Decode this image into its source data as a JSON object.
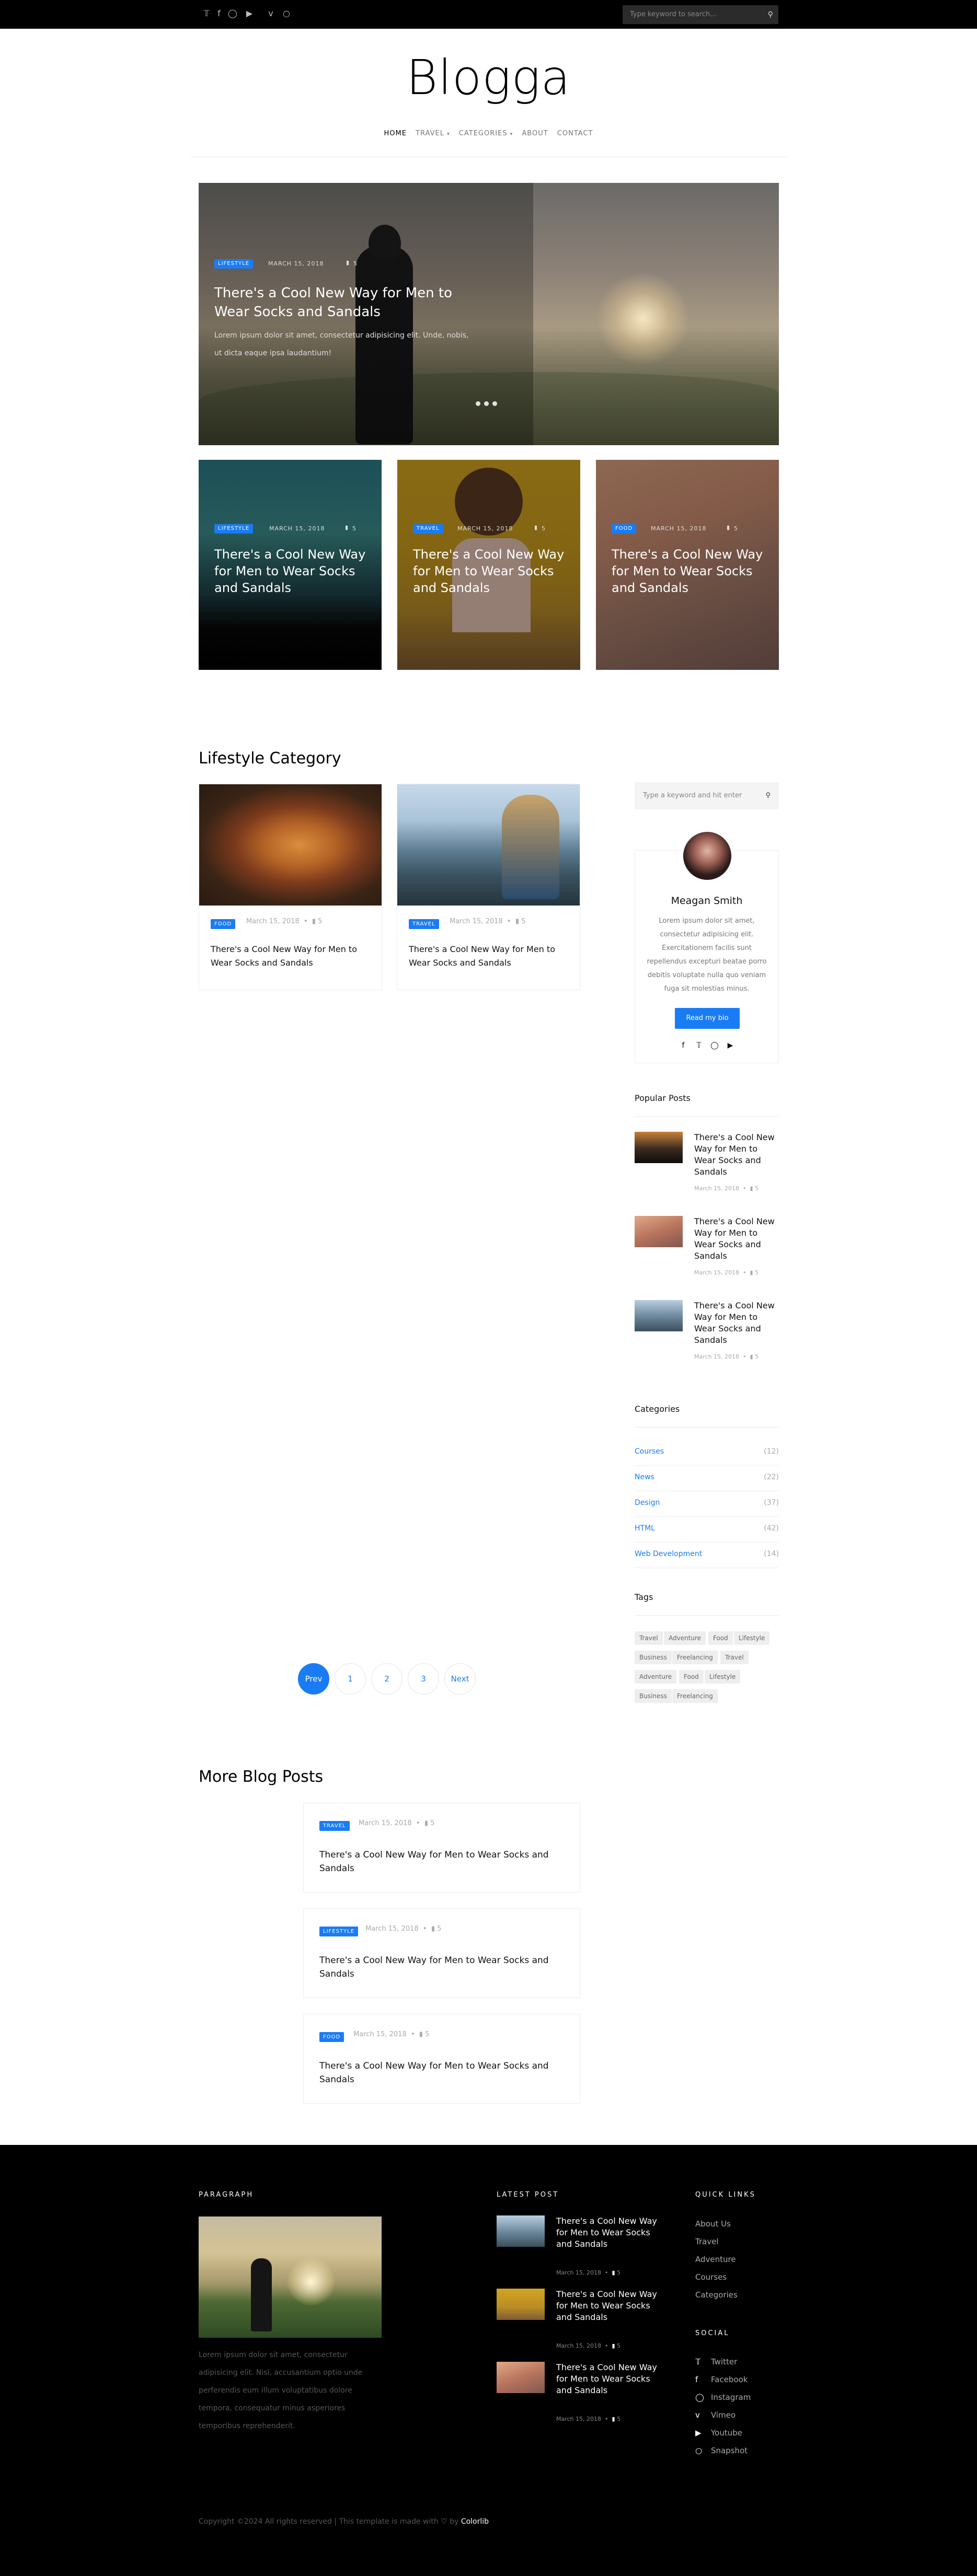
{
  "top_bar": {
    "social": [
      "twitter-icon",
      "facebook-icon",
      "instagram-icon",
      "youtube-icon",
      "vimeo-icon",
      "snapchat-icon"
    ],
    "search_placeholder": "Type keyword to search..."
  },
  "site": {
    "logo": "Blogga"
  },
  "nav": [
    "HOME",
    "TRAVEL",
    "CATEGORIES",
    "ABOUT",
    "CONTACT"
  ],
  "hero": {
    "category": "LIFESTYLE",
    "date": "MARCH 15, 2018",
    "comments": "5",
    "title": "There's a Cool New Way for Men to Wear Socks and Sandals",
    "excerpt": "Lorem ipsum dolor sit amet, consectetur adipisicing elit. Unde, nobis, ut dicta eaque ipsa laudantium!"
  },
  "featured": [
    {
      "category": "LIFESTYLE",
      "date": "MARCH 15, 2018",
      "comments": "5",
      "title": "There's a Cool New Way for Men to Wear Socks and Sandals"
    },
    {
      "category": "TRAVEL",
      "date": "MARCH 15, 2018",
      "comments": "5",
      "title": "There's a Cool New Way for Men to Wear Socks and Sandals"
    },
    {
      "category": "FOOD",
      "date": "MARCH 15, 2018",
      "comments": "5",
      "title": "There's a Cool New Way for Men to Wear Socks and Sandals"
    }
  ],
  "lifestyle": {
    "heading": "Lifestyle Category",
    "posts": [
      {
        "category": "FOOD",
        "date": "March 15, 2018",
        "comments": "5",
        "title": "There's a Cool New Way for Men to Wear Socks and Sandals"
      },
      {
        "category": "TRAVEL",
        "date": "March 15, 2018",
        "comments": "5",
        "title": "There's a Cool New Way for Men to Wear Socks and Sandals"
      }
    ]
  },
  "sidebar": {
    "search_placeholder": "Type a keyword and hit enter",
    "bio": {
      "name": "Meagan Smith",
      "text": "Lorem ipsum dolor sit amet, consectetur adipisicing elit. Exercitationem facilis sunt repellendus excepturi beatae porro debitis voluptate nulla quo veniam fuga sit molestias minus.",
      "button": "Read my bio"
    },
    "popular_heading": "Popular Posts",
    "popular": [
      {
        "title": "There's a Cool New Way for Men to Wear Socks and Sandals",
        "date": "March 15, 2018",
        "comments": "5"
      },
      {
        "title": "There's a Cool New Way for Men to Wear Socks and Sandals",
        "date": "March 15, 2018",
        "comments": "5"
      },
      {
        "title": "There's a Cool New Way for Men to Wear Socks and Sandals",
        "date": "March 15, 2018",
        "comments": "5"
      }
    ],
    "categories_heading": "Categories",
    "categories": [
      {
        "name": "Courses",
        "count": "(12)"
      },
      {
        "name": "News",
        "count": "(22)"
      },
      {
        "name": "Design",
        "count": "(37)"
      },
      {
        "name": "HTML",
        "count": "(42)"
      },
      {
        "name": "Web Development",
        "count": "(14)"
      }
    ],
    "tags_heading": "Tags",
    "tags": [
      "Travel",
      "Adventure",
      "Food",
      "Lifestyle",
      "Business",
      "Freelancing",
      "Travel",
      "Adventure",
      "Food",
      "Lifestyle",
      "Business",
      "Freelancing"
    ]
  },
  "pagination": [
    "Prev",
    "1",
    "2",
    "3",
    "Next"
  ],
  "more_blog": {
    "heading": "More Blog Posts",
    "posts": [
      {
        "category": "TRAVEL",
        "date": "March 15, 2018",
        "comments": "5",
        "title": "There's a Cool New Way for Men to Wear Socks and Sandals"
      },
      {
        "category": "LIFESTYLE",
        "date": "March 15, 2018",
        "comments": "5",
        "title": "There's a Cool New Way for Men to Wear Socks and Sandals"
      },
      {
        "category": "FOOD",
        "date": "March 15, 2018",
        "comments": "5",
        "title": "There's a Cool New Way for Men to Wear Socks and Sandals"
      }
    ]
  },
  "footer": {
    "paragraph_heading": "PARAGRAPH",
    "paragraph": "Lorem ipsum dolor sit amet, consectetur adipisicing elit. Nisi, accusantium optio unde perferendis eum illum voluptatibus dolore tempora, consequatur minus asperiores temporibus reprehenderit.",
    "latest_heading": "LATEST POST",
    "latest": [
      {
        "title": "There's a Cool New Way for Men to Wear Socks and Sandals",
        "date": "March 15, 2018",
        "comments": "5"
      },
      {
        "title": "There's a Cool New Way for Men to Wear Socks and Sandals",
        "date": "March 15, 2018",
        "comments": "5"
      },
      {
        "title": "There's a Cool New Way for Men to Wear Socks and Sandals",
        "date": "March 15, 2018",
        "comments": "5"
      }
    ],
    "quick_heading": "QUICK LINKS",
    "quick_links": [
      "About Us",
      "Travel",
      "Adventure",
      "Courses",
      "Categories"
    ],
    "social_heading": "SOCIAL",
    "social": [
      {
        "label": "Twitter",
        "icon": "twitter-icon"
      },
      {
        "label": "Facebook",
        "icon": "facebook-icon"
      },
      {
        "label": "Instagram",
        "icon": "instagram-icon"
      },
      {
        "label": "Vimeo",
        "icon": "vimeo-icon"
      },
      {
        "label": "Youtube",
        "icon": "youtube-icon"
      },
      {
        "label": "Snapshot",
        "icon": "snapchat-icon"
      }
    ],
    "copyright": "Copyright ©2024 All rights reserved | This template is made with",
    "copyright_by": "by",
    "copyright_brand": "Colorlib"
  },
  "colors": {
    "accent": "#1a7cf5",
    "dark": "#000000"
  }
}
